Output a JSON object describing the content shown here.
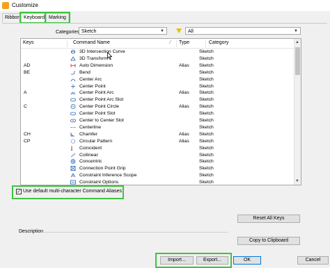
{
  "window": {
    "title": "Customize"
  },
  "tabs": [
    {
      "label": "Ribbon"
    },
    {
      "label": "Keyboard"
    },
    {
      "label": "Marking Menu"
    }
  ],
  "filters": {
    "categories_label": "Categories",
    "categories_value": "Sketch",
    "filter_value": "All"
  },
  "table": {
    "headers": {
      "keys": "Keys",
      "command": "Command Name",
      "type": "Type",
      "category": "Category"
    },
    "rows": [
      {
        "keys": "",
        "command": "3D Intersection Curve",
        "type": "",
        "category": "Sketch",
        "icon": "intersection-curve-icon"
      },
      {
        "keys": "",
        "command": "3D Transform",
        "type": "",
        "category": "Sketch",
        "icon": "transform-icon"
      },
      {
        "keys": "AD",
        "command": "Auto Dimension",
        "type": "Alias",
        "category": "Sketch",
        "icon": "auto-dimension-icon"
      },
      {
        "keys": "BE",
        "command": "Bend",
        "type": "",
        "category": "Sketch",
        "icon": "bend-icon"
      },
      {
        "keys": "",
        "command": "Center Arc",
        "type": "",
        "category": "Sketch",
        "icon": "center-arc-icon"
      },
      {
        "keys": "",
        "command": "Center Point",
        "type": "",
        "category": "Sketch",
        "icon": "center-point-icon"
      },
      {
        "keys": "A",
        "command": "Center Point Arc",
        "type": "Alias",
        "category": "Sketch",
        "icon": "center-point-arc-icon"
      },
      {
        "keys": "",
        "command": "Center Point Arc Slot",
        "type": "",
        "category": "Sketch",
        "icon": "arc-slot-icon"
      },
      {
        "keys": "C",
        "command": "Center Point Circle",
        "type": "Alias",
        "category": "Sketch",
        "icon": "circle-icon"
      },
      {
        "keys": "",
        "command": "Center Point Slot",
        "type": "",
        "category": "Sketch",
        "icon": "slot-icon"
      },
      {
        "keys": "",
        "command": "Center to Center Slot",
        "type": "",
        "category": "Sketch",
        "icon": "center-slot-icon"
      },
      {
        "keys": "",
        "command": "Centerline",
        "type": "",
        "category": "Sketch",
        "icon": "centerline-icon"
      },
      {
        "keys": "CH",
        "command": "Chamfer",
        "type": "Alias",
        "category": "Sketch",
        "icon": "chamfer-icon"
      },
      {
        "keys": "CP",
        "command": "Circular Pattern",
        "type": "Alias",
        "category": "Sketch",
        "icon": "circular-pattern-icon"
      },
      {
        "keys": "",
        "command": "Coincident",
        "type": "",
        "category": "Sketch",
        "icon": "coincident-icon"
      },
      {
        "keys": "",
        "command": "Collinear",
        "type": "",
        "category": "Sketch",
        "icon": "collinear-icon"
      },
      {
        "keys": "",
        "command": "Concentric",
        "type": "",
        "category": "Sketch",
        "icon": "concentric-icon"
      },
      {
        "keys": "",
        "command": "Connection Point Grip",
        "type": "",
        "category": "Sketch",
        "icon": "grip-icon"
      },
      {
        "keys": "",
        "command": "Constraint Inference Scope",
        "type": "",
        "category": "Sketch",
        "icon": "inference-icon"
      },
      {
        "keys": "",
        "command": "Constraint Options",
        "type": "",
        "category": "Sketch",
        "icon": "options-icon"
      }
    ]
  },
  "checkbox": {
    "label": "Use default multi-character Command Aliases",
    "checked": true
  },
  "buttons": {
    "reset_all_keys": "Reset All Keys",
    "copy_to_clipboard": "Copy to Clipboard",
    "import": "Import...",
    "export": "Export...",
    "ok": "OK",
    "cancel": "Cancel"
  },
  "description_label": "Description",
  "colors": {
    "highlight": "#3ec43e",
    "icon_blue": "#1a5fb4",
    "filter_yellow": "#e8c000"
  }
}
